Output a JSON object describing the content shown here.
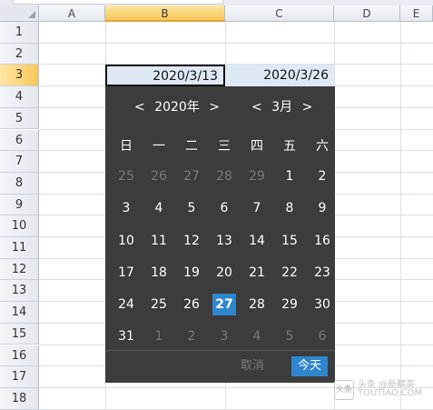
{
  "sheet": {
    "columns": [
      "A",
      "B",
      "C",
      "D",
      "E"
    ],
    "rows": [
      "1",
      "2",
      "3",
      "4",
      "5",
      "6",
      "7",
      "8",
      "9",
      "10",
      "11",
      "12",
      "13",
      "14",
      "15",
      "16",
      "17",
      "18"
    ],
    "cells": {
      "B3": "2020/3/13",
      "C3": "2020/3/26"
    }
  },
  "picker": {
    "year_prev": "<",
    "year_label": "2020年",
    "year_next": ">",
    "month_prev": "<",
    "month_label": "3月",
    "month_next": ">",
    "weekdays": [
      "日",
      "一",
      "二",
      "三",
      "四",
      "五",
      "六"
    ],
    "weeks": [
      [
        "25",
        "26",
        "27",
        "28",
        "29",
        "1",
        "2"
      ],
      [
        "3",
        "4",
        "5",
        "6",
        "7",
        "8",
        "9"
      ],
      [
        "10",
        "11",
        "12",
        "13",
        "14",
        "15",
        "16"
      ],
      [
        "17",
        "18",
        "19",
        "20",
        "21",
        "22",
        "23"
      ],
      [
        "24",
        "25",
        "26",
        "27",
        "28",
        "29",
        "30"
      ],
      [
        "31",
        "1",
        "2",
        "3",
        "4",
        "5",
        "6"
      ]
    ],
    "today_day": "27",
    "cancel_label": "取消",
    "today_label": "今天"
  },
  "watermark": {
    "line1": "头条 @新精英",
    "line2": "TOUTIAO.COM"
  },
  "colors": {
    "picker_bg": "#3c3c3c",
    "accent": "#2f86cf",
    "selected_header": "#f6c65a",
    "cell_fill": "#dfe8f5"
  }
}
